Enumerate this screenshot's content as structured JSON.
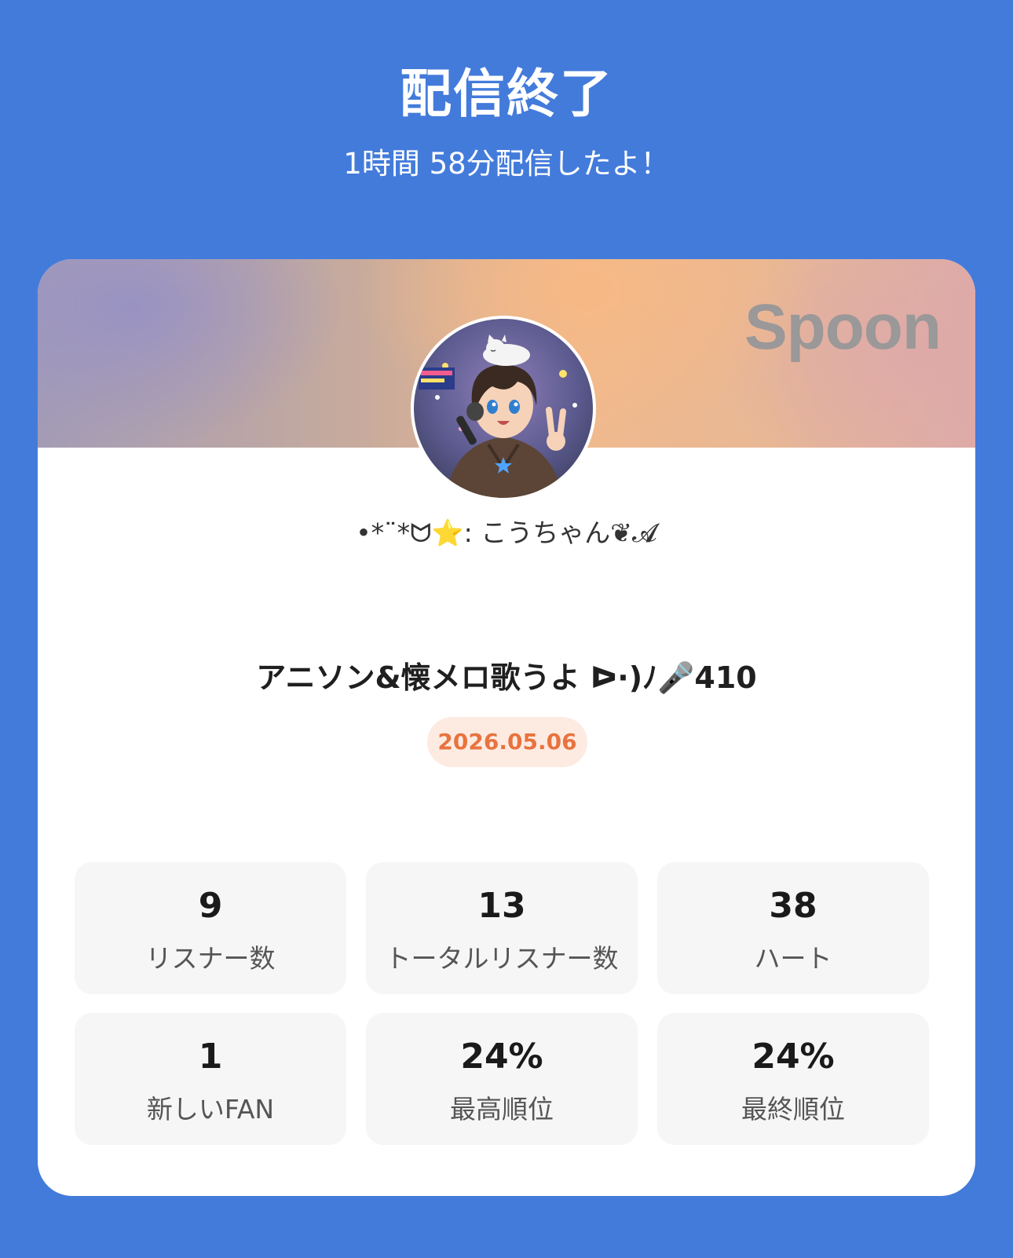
{
  "header": {
    "title": "配信終了",
    "subtitle": "1時間 58分配信したよ！"
  },
  "card": {
    "brand": "Spoon",
    "username": "•*¨*ᗢ⭐️: こうちゃん❦𝓐",
    "stream_title": "アニソン&懐メロ歌うよ ᐅ·)ﾉ🎤410",
    "date": "2026.05.06",
    "stats": [
      {
        "value": "9",
        "label": "リスナー数"
      },
      {
        "value": "13",
        "label": "トータルリスナー数"
      },
      {
        "value": "38",
        "label": "ハート"
      },
      {
        "value": "1",
        "label": "新しいFAN"
      },
      {
        "value": "24%",
        "label": "最高順位"
      },
      {
        "value": "24%",
        "label": "最終順位"
      }
    ]
  },
  "colors": {
    "background": "#437bdb",
    "date_text": "#e8733f",
    "date_badge": "#fdebe2",
    "stat_tile": "#f6f6f6"
  },
  "icons": {
    "avatar": "anime-boy-with-microphone-avatar"
  }
}
